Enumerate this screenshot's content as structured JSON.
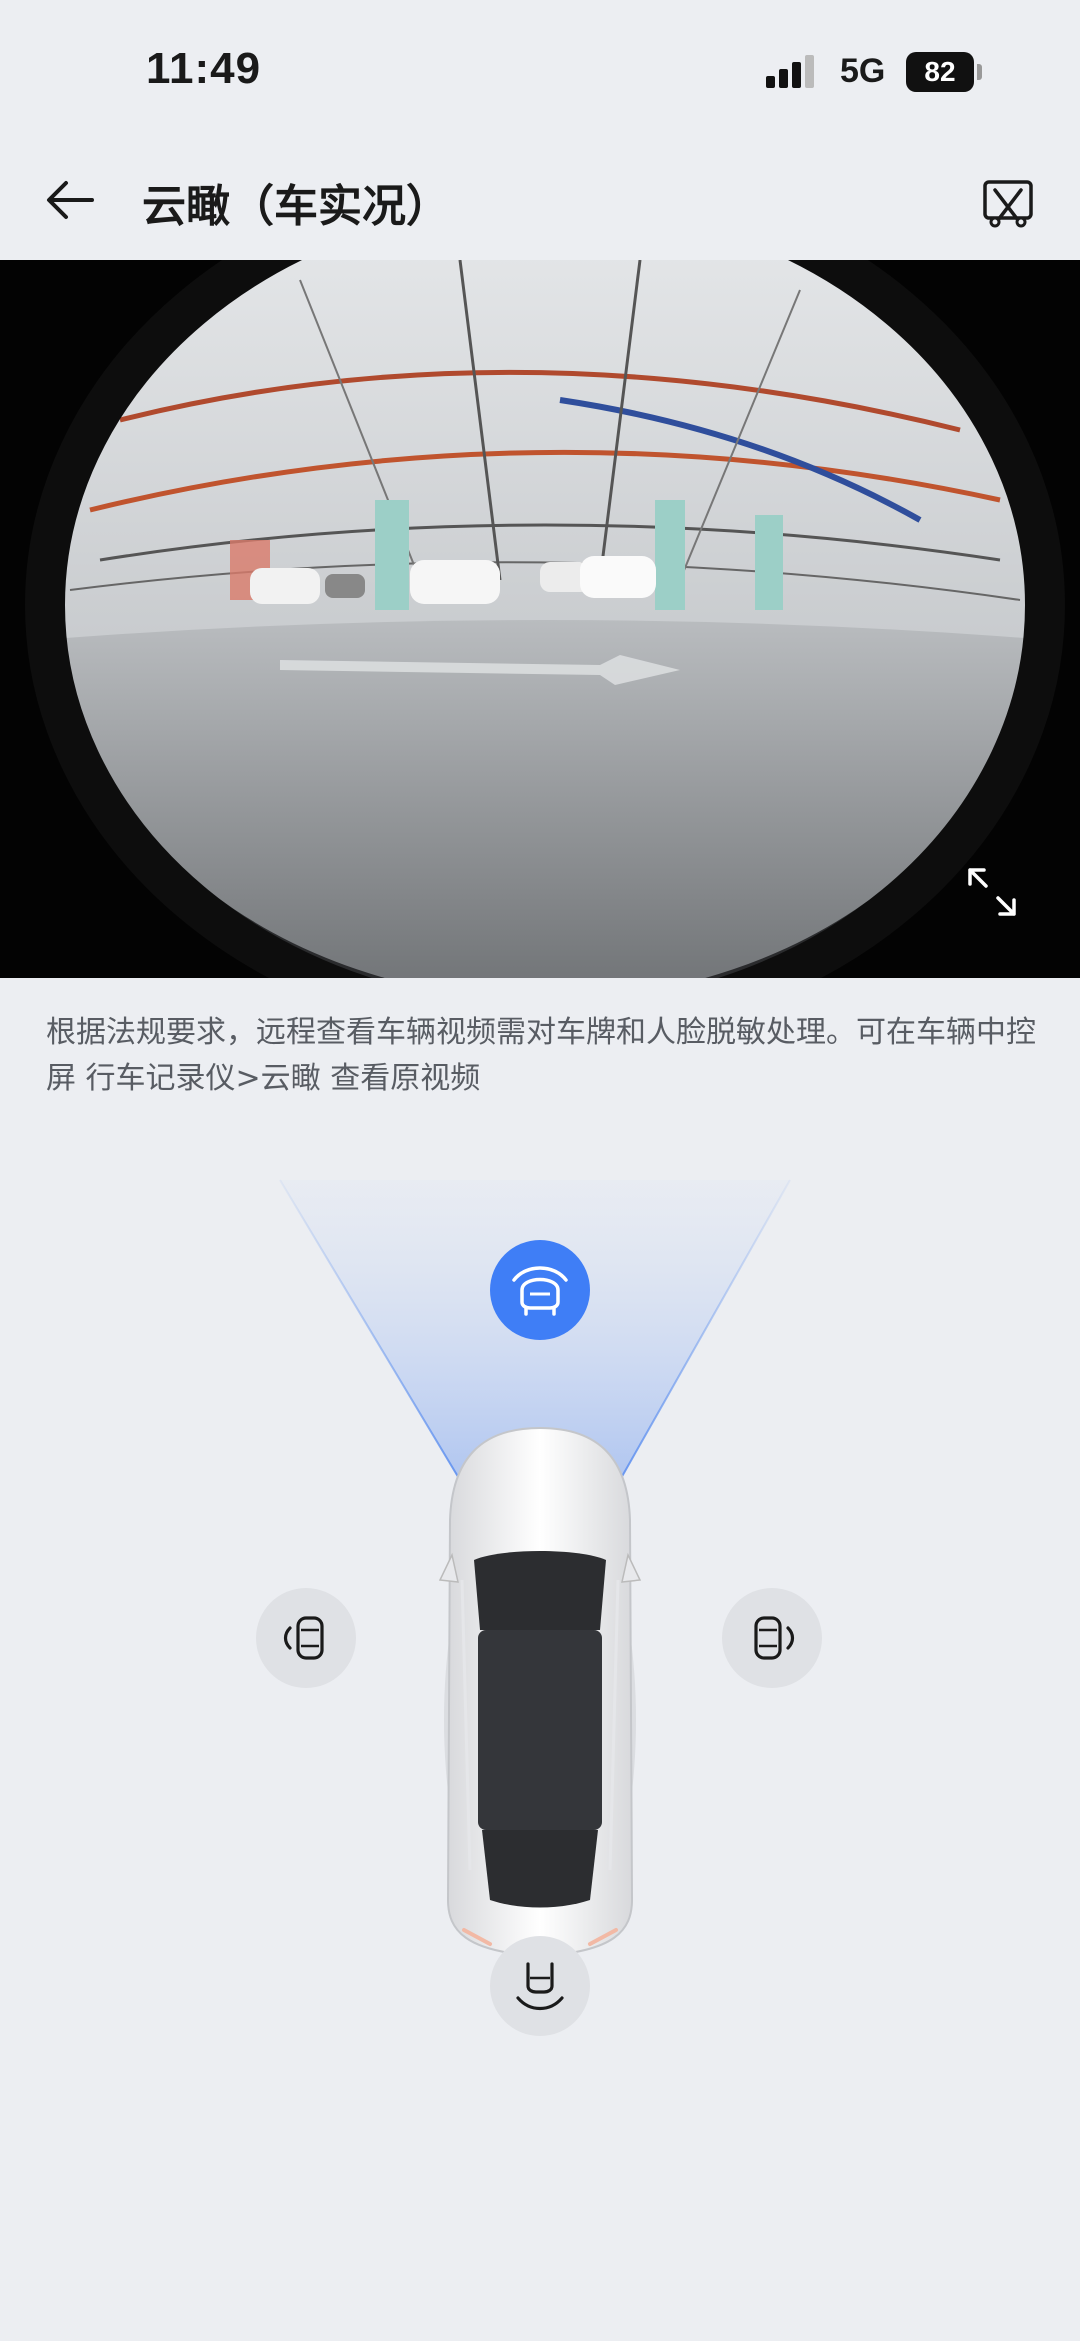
{
  "status_bar": {
    "time": "11:49",
    "network": "5G",
    "battery_level": "82",
    "signal_icon": "cellular-signal-icon"
  },
  "header": {
    "title": "云瞰（车实况）",
    "back_icon": "back-arrow-icon",
    "cast_icon": "screen-cast-icon"
  },
  "video": {
    "expand_icon": "fullscreen-expand-icon"
  },
  "notice": {
    "text": "根据法规要求，远程查看车辆视频需对车牌和人脸脱敏处理。可在车辆中控屏 行车记录仪>云瞰 查看原视频"
  },
  "cameras": [
    {
      "id": "front",
      "icon": "front-camera-icon",
      "active": true
    },
    {
      "id": "left",
      "icon": "left-camera-icon",
      "active": false
    },
    {
      "id": "right",
      "icon": "right-camera-icon",
      "active": false
    },
    {
      "id": "rear",
      "icon": "rear-camera-icon",
      "active": false
    }
  ],
  "colors": {
    "accent": "#3f7ef6",
    "background": "#eceef2",
    "inactive_button": "#dfe1e5"
  }
}
